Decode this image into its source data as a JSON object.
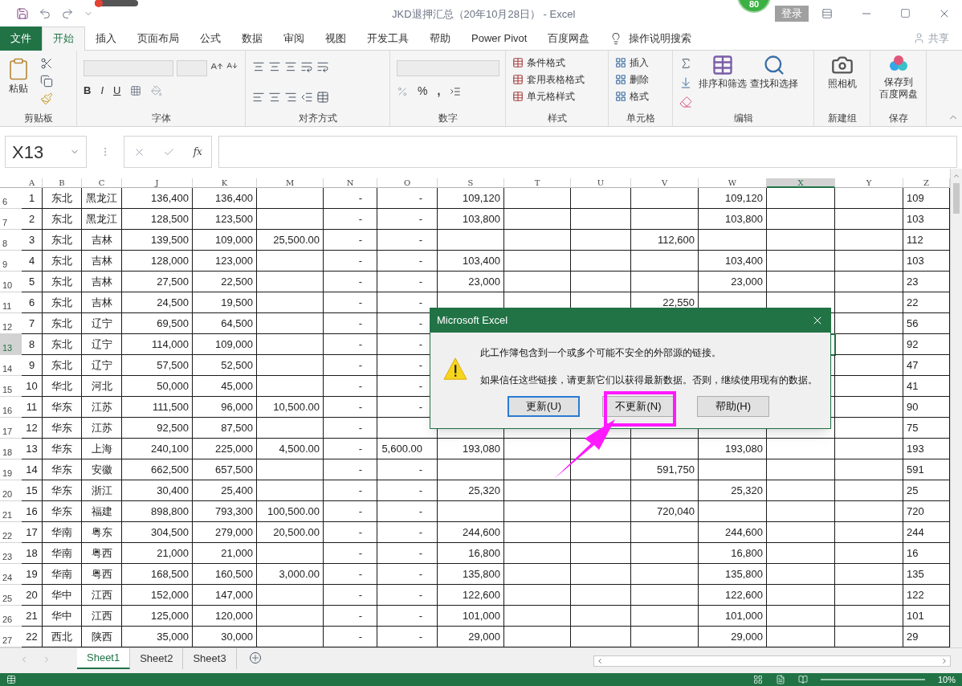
{
  "window": {
    "title": "JKD退押汇总（20年10月28日） - Excel",
    "badge": "80",
    "login": "登录"
  },
  "tabs": [
    {
      "label": "文件",
      "kind": "file",
      "selected": false
    },
    {
      "label": "开始",
      "kind": "tab",
      "selected": true
    },
    {
      "label": "插入",
      "kind": "tab",
      "selected": false
    },
    {
      "label": "页面布局",
      "kind": "tab",
      "selected": false
    },
    {
      "label": "公式",
      "kind": "tab",
      "selected": false
    },
    {
      "label": "数据",
      "kind": "tab",
      "selected": false
    },
    {
      "label": "审阅",
      "kind": "tab",
      "selected": false
    },
    {
      "label": "视图",
      "kind": "tab",
      "selected": false
    },
    {
      "label": "开发工具",
      "kind": "tab",
      "selected": false
    },
    {
      "label": "帮助",
      "kind": "tab",
      "selected": false
    },
    {
      "label": "Power Pivot",
      "kind": "tab",
      "selected": false
    },
    {
      "label": "百度网盘",
      "kind": "tab",
      "selected": false
    }
  ],
  "tell_me": "操作说明搜索",
  "share": "共享",
  "ribbon": {
    "clipboard": {
      "paste": "粘贴",
      "label": "剪贴板"
    },
    "font": {
      "bold": "B",
      "italic": "I",
      "underline": "U",
      "label": "字体"
    },
    "alignment": {
      "label": "对齐方式"
    },
    "number": {
      "percent": "%",
      "comma": ",",
      "label": "数字"
    },
    "styles": {
      "items": [
        "条件格式",
        "套用表格格式",
        "单元格样式"
      ],
      "label": "样式"
    },
    "cells": {
      "items": [
        "插入",
        "删除",
        "格式"
      ],
      "label": "单元格"
    },
    "editing": {
      "sort": "排序和筛选",
      "find": "查找和选择",
      "label": "编辑"
    },
    "new_group": {
      "camera": "照相机",
      "label": "新建组"
    },
    "save": {
      "lines": [
        "保存到",
        "百度网盘"
      ],
      "label": "保存"
    }
  },
  "formula_bar": {
    "name_box": "X13",
    "fx": "fx"
  },
  "columns": [
    {
      "label": "A",
      "selected": false
    },
    {
      "label": "B",
      "selected": false
    },
    {
      "label": "C",
      "selected": false
    },
    {
      "label": "J",
      "selected": false
    },
    {
      "label": "K",
      "selected": false
    },
    {
      "label": "M",
      "selected": false
    },
    {
      "label": "N",
      "selected": false
    },
    {
      "label": "O",
      "selected": false
    },
    {
      "label": "S",
      "selected": false
    },
    {
      "label": "T",
      "selected": false
    },
    {
      "label": "U",
      "selected": false
    },
    {
      "label": "V",
      "selected": false
    },
    {
      "label": "W",
      "selected": false
    },
    {
      "label": "X",
      "selected": true
    },
    {
      "label": "Y",
      "selected": false
    },
    {
      "label": "Z",
      "selected": false
    }
  ],
  "rows": [
    {
      "header": "6",
      "selected": false,
      "cells": [
        "1",
        "东北",
        "黑龙江",
        "136,400",
        "136,400",
        null,
        "-",
        "-",
        "109,120",
        null,
        null,
        null,
        "109,120",
        null,
        null,
        "109"
      ]
    },
    {
      "header": "7",
      "selected": false,
      "cells": [
        "2",
        "东北",
        "黑龙江",
        "128,500",
        "123,500",
        null,
        "-",
        "-",
        "103,800",
        null,
        null,
        null,
        "103,800",
        null,
        null,
        "103"
      ]
    },
    {
      "header": "8",
      "selected": false,
      "cells": [
        "3",
        "东北",
        "吉林",
        "139,500",
        "109,000",
        "25,500.00",
        "-",
        "-",
        null,
        null,
        null,
        "112,600",
        null,
        null,
        null,
        "112"
      ]
    },
    {
      "header": "9",
      "selected": false,
      "cells": [
        "4",
        "东北",
        "吉林",
        "128,000",
        "123,000",
        null,
        "-",
        "-",
        "103,400",
        null,
        null,
        null,
        "103,400",
        null,
        null,
        "103"
      ]
    },
    {
      "header": "10",
      "selected": false,
      "cells": [
        "5",
        "东北",
        "吉林",
        "27,500",
        "22,500",
        null,
        "-",
        "-",
        "23,000",
        null,
        null,
        null,
        "23,000",
        null,
        null,
        "23"
      ]
    },
    {
      "header": "11",
      "selected": false,
      "cells": [
        "6",
        "东北",
        "吉林",
        "24,500",
        "19,500",
        null,
        "-",
        "-",
        null,
        null,
        null,
        "22,550",
        null,
        null,
        null,
        "22"
      ]
    },
    {
      "header": "12",
      "selected": false,
      "cells": [
        "7",
        "东北",
        "辽宁",
        "69,500",
        "64,500",
        null,
        "-",
        "-",
        null,
        null,
        null,
        null,
        null,
        null,
        null,
        "56"
      ]
    },
    {
      "header": "13",
      "selected": true,
      "cells": [
        "8",
        "东北",
        "辽宁",
        "114,000",
        "109,000",
        null,
        "-",
        "-",
        null,
        null,
        null,
        null,
        null,
        null,
        null,
        "92"
      ]
    },
    {
      "header": "14",
      "selected": false,
      "cells": [
        "9",
        "东北",
        "辽宁",
        "57,500",
        "52,500",
        null,
        "-",
        "-",
        null,
        null,
        null,
        null,
        null,
        null,
        null,
        "47"
      ]
    },
    {
      "header": "15",
      "selected": false,
      "cells": [
        "10",
        "华北",
        "河北",
        "50,000",
        "45,000",
        null,
        "-",
        "-",
        null,
        null,
        null,
        null,
        null,
        null,
        null,
        "41"
      ]
    },
    {
      "header": "16",
      "selected": false,
      "cells": [
        "11",
        "华东",
        "江苏",
        "111,500",
        "96,000",
        "10,500.00",
        "-",
        "-",
        null,
        null,
        null,
        null,
        null,
        null,
        null,
        "90"
      ]
    },
    {
      "header": "17",
      "selected": false,
      "cells": [
        "12",
        "华东",
        "江苏",
        "92,500",
        "87,500",
        null,
        "-",
        null,
        null,
        null,
        null,
        null,
        null,
        null,
        null,
        "75"
      ]
    },
    {
      "header": "18",
      "selected": false,
      "cells": [
        "13",
        "华东",
        "上海",
        "240,100",
        "225,000",
        "4,500.00",
        "-",
        "5,600.00",
        "193,080",
        null,
        null,
        null,
        "193,080",
        null,
        null,
        "193"
      ]
    },
    {
      "header": "19",
      "selected": false,
      "cells": [
        "14",
        "华东",
        "安徽",
        "662,500",
        "657,500",
        null,
        "-",
        "-",
        null,
        null,
        null,
        "591,750",
        null,
        null,
        null,
        "591"
      ]
    },
    {
      "header": "20",
      "selected": false,
      "cells": [
        "15",
        "华东",
        "浙江",
        "30,400",
        "25,400",
        null,
        "-",
        "-",
        "25,320",
        null,
        null,
        null,
        "25,320",
        null,
        null,
        "25"
      ]
    },
    {
      "header": "21",
      "selected": false,
      "cells": [
        "16",
        "华东",
        "福建",
        "898,800",
        "793,300",
        "100,500.00",
        "-",
        "-",
        null,
        null,
        null,
        "720,040",
        null,
        null,
        null,
        "720"
      ]
    },
    {
      "header": "22",
      "selected": false,
      "cells": [
        "17",
        "华南",
        "粤东",
        "304,500",
        "279,000",
        "20,500.00",
        "-",
        "-",
        "244,600",
        null,
        null,
        null,
        "244,600",
        null,
        null,
        "244"
      ]
    },
    {
      "header": "23",
      "selected": false,
      "cells": [
        "18",
        "华南",
        "粤西",
        "21,000",
        "21,000",
        null,
        "-",
        "-",
        "16,800",
        null,
        null,
        null,
        "16,800",
        null,
        null,
        "16"
      ]
    },
    {
      "header": "24",
      "selected": false,
      "cells": [
        "19",
        "华南",
        "粤西",
        "168,500",
        "160,500",
        "3,000.00",
        "-",
        "-",
        "135,800",
        null,
        null,
        null,
        "135,800",
        null,
        null,
        "135"
      ]
    },
    {
      "header": "25",
      "selected": false,
      "cells": [
        "20",
        "华中",
        "江西",
        "152,000",
        "147,000",
        null,
        "-",
        "-",
        "122,600",
        null,
        null,
        null,
        "122,600",
        null,
        null,
        "122"
      ]
    },
    {
      "header": "26",
      "selected": false,
      "cells": [
        "21",
        "华中",
        "江西",
        "125,000",
        "120,000",
        null,
        "-",
        "-",
        "101,000",
        null,
        null,
        null,
        "101,000",
        null,
        null,
        "101"
      ]
    },
    {
      "header": "27",
      "selected": false,
      "cells": [
        "22",
        "西北",
        "陕西",
        "35,000",
        "30,000",
        null,
        "-",
        "-",
        "29,000",
        null,
        null,
        null,
        "29,000",
        null,
        null,
        "29"
      ]
    }
  ],
  "sheets": [
    {
      "label": "Sheet1",
      "selected": true
    },
    {
      "label": "Sheet2",
      "selected": false
    },
    {
      "label": "Sheet3",
      "selected": false
    }
  ],
  "status_bar": {
    "zoom": "10%"
  },
  "dialog": {
    "title": "Microsoft Excel",
    "messages": [
      "此工作簿包含到一个或多个可能不安全的外部源的链接。",
      "如果信任这些链接，请更新它们以获得最新数据。否则，继续使用现有的数据。"
    ],
    "buttons": [
      {
        "label": "更新(U)",
        "default": true,
        "highlighted": false
      },
      {
        "label": "不更新(N)",
        "default": false,
        "highlighted": true
      },
      {
        "label": "帮助(H)",
        "default": false,
        "highlighted": false
      }
    ]
  }
}
